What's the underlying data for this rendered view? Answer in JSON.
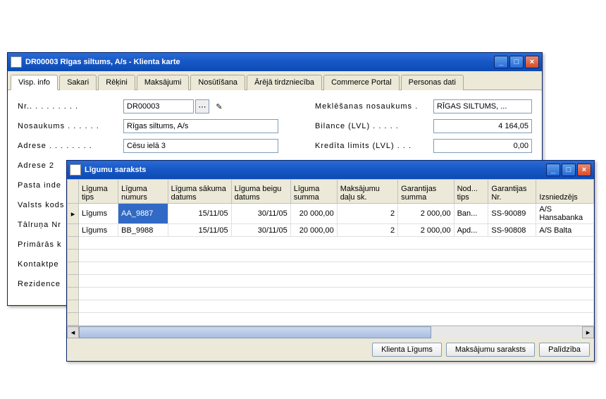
{
  "win1": {
    "title": "DR00003 Rīgas siltums, A/s - Klienta karte",
    "tabs": [
      "Visp. info",
      "Sakari",
      "Rēķini",
      "Maksājumi",
      "Nosūtīšana",
      "Ārējā tirdzniecība",
      "Commerce Portal",
      "Personas dati"
    ],
    "fields": {
      "nr_label": "Nr.",
      "nr_value": "DR00003",
      "nosaukums_label": "Nosaukums",
      "nosaukums_value": "Rīgas siltums, A/s",
      "adrese_label": "Adrese",
      "adrese_value": "Cēsu ielā 3",
      "adrese2_label": "Adrese 2",
      "pasta_label": "Pasta inde",
      "valsts_label": "Valsts kods",
      "talruna_label": "Tālruņa Nr",
      "primaras_label": "Primārās k",
      "kontaktp_label": "Kontaktpe",
      "rezidence_label": "Rezidence",
      "mekl_label": "Meklēšanas nosaukums",
      "mekl_value": "RĪGAS SILTUMS, ...",
      "bilance_label": "Bilance (LVL)",
      "bilance_value": "4 164,05",
      "kredit_label": "Kredīta limits (LVL)",
      "kredit_value": "0,00"
    }
  },
  "win2": {
    "title": "Līgumu saraksts",
    "columns": [
      "Līguma tips",
      "Līguma numurs",
      "Līguma sākuma datums",
      "Līguma beigu datums",
      "Līguma summa",
      "Maksājumu daļu sk.",
      "Garantijas summa",
      "Nod... tips",
      "Garantijas Nr.",
      "Izsniedzējs"
    ],
    "rows": [
      {
        "tips": "Līgums",
        "numurs": "AA_9887",
        "sakuma": "15/11/05",
        "beigu": "30/11/05",
        "summa": "20 000,00",
        "dalu": "2",
        "garant": "2 000,00",
        "nod": "Ban...",
        "gnr": "SS-90089",
        "izsn": "A/S Hansabanka"
      },
      {
        "tips": "Līgums",
        "numurs": "BB_9988",
        "sakuma": "15/11/05",
        "beigu": "30/11/05",
        "summa": "20 000,00",
        "dalu": "2",
        "garant": "2 000,00",
        "nod": "Apd...",
        "gnr": "SS-90808",
        "izsn": "A/S Balta"
      }
    ],
    "buttons": {
      "klienta": "Klienta Līgums",
      "maksajumu": "Maksājumu saraksts",
      "palidziba": "Palīdzība"
    }
  }
}
